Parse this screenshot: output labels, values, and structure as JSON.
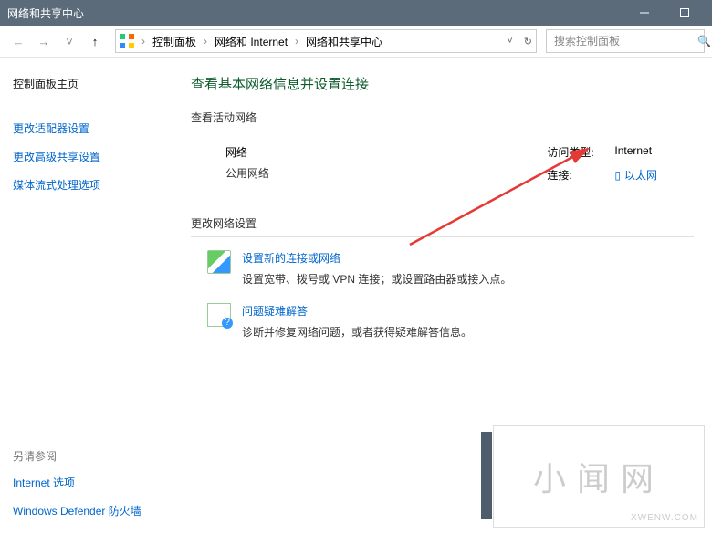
{
  "window": {
    "title": "网络和共享中心"
  },
  "breadcrumb": {
    "a": "控制面板",
    "b": "网络和 Internet",
    "c": "网络和共享中心"
  },
  "search": {
    "placeholder": "搜索控制面板"
  },
  "sidebar": {
    "home": "控制面板主页",
    "items": [
      "更改适配器设置",
      "更改高级共享设置",
      "媒体流式处理选项"
    ],
    "seealso": "另请参阅",
    "footer": [
      "Internet 选项",
      "Windows Defender 防火墙"
    ]
  },
  "main": {
    "heading": "查看基本网络信息并设置连接",
    "active_title": "查看活动网络",
    "net": {
      "name": "网络",
      "type": "公用网络"
    },
    "right": {
      "access_k": "访问类型:",
      "access_v": "Internet",
      "conn_k": "连接:",
      "conn_v": "以太网"
    },
    "change_title": "更改网络设置",
    "opts": [
      {
        "title": "设置新的连接或网络",
        "desc": "设置宽带、拨号或 VPN 连接；或设置路由器或接入点。"
      },
      {
        "title": "问题疑难解答",
        "desc": "诊断并修复网络问题，或者获得疑难解答信息。"
      }
    ]
  },
  "watermark": {
    "big": "小闻网",
    "small": "XWENW.COM"
  }
}
